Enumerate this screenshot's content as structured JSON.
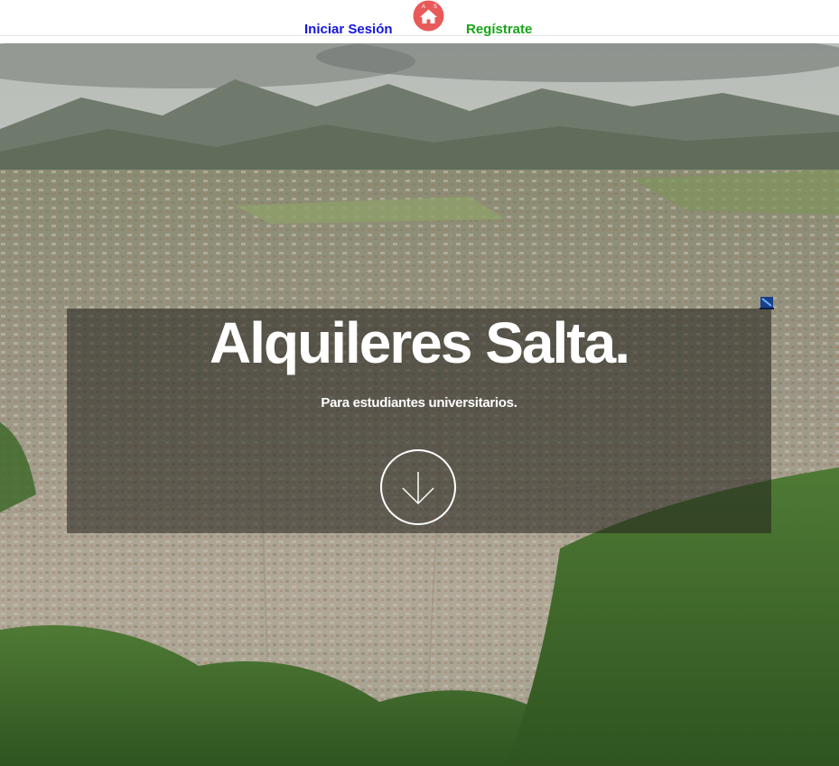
{
  "nav": {
    "login_label": "Iniciar Sesión",
    "register_label": "Regístrate",
    "logo_letters": "A S",
    "login_color": "#1515e0",
    "register_color": "#17a517",
    "logo_color": "#e85a5a"
  },
  "hero": {
    "title": "Alquileres Salta.",
    "subtitle": "Para estudiantes universitarios.",
    "background": "aerial city panorama with mountains",
    "scroll_icon": "arrow-down-circle-icon"
  },
  "overlay_icon": "monitor-badge-icon"
}
